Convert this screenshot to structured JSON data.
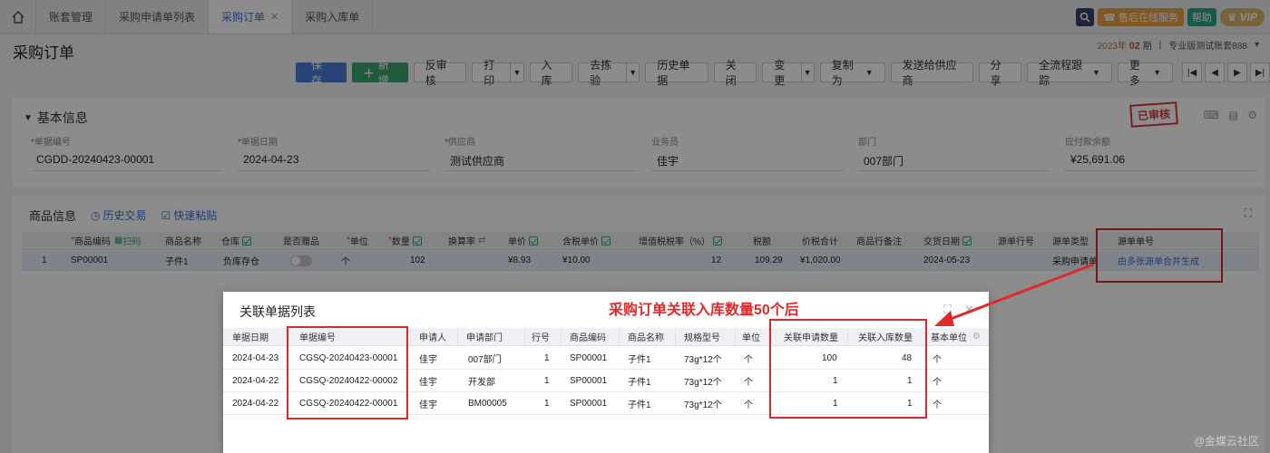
{
  "tabs": [
    {
      "label": "账套管理",
      "active": false
    },
    {
      "label": "采购申请单列表",
      "active": false
    },
    {
      "label": "采购订单",
      "active": true,
      "closable": true
    },
    {
      "label": "采购入库单",
      "active": false
    }
  ],
  "topbar": {
    "service": "售后在线服务",
    "help": "帮助",
    "vip": "VIP"
  },
  "page_title": "采购订单",
  "period": {
    "year": "2023年",
    "month": "02",
    "month_suffix": "期",
    "account": "专业版测试账套888"
  },
  "toolbar": {
    "save": "保存",
    "new": "新增",
    "unapprove": "反审核",
    "print": "打印",
    "stock_in": "入库",
    "inspect": "去拣验",
    "history": "历史单据",
    "close": "关闭",
    "change": "变更",
    "copy_as": "复制为",
    "send_supplier": "发送给供应商",
    "share": "分享",
    "track": "全流程跟踪",
    "more": "更多"
  },
  "basic_info": {
    "title": "基本信息",
    "stamp": "已审核",
    "fields": [
      {
        "label": "单据编号",
        "required": true,
        "value": "CGDD-20240423-00001"
      },
      {
        "label": "单据日期",
        "required": true,
        "value": "2024-04-23"
      },
      {
        "label": "供应商",
        "required": true,
        "value": "测试供应商"
      },
      {
        "label": "业务员",
        "required": false,
        "value": "佳宇"
      },
      {
        "label": "部门",
        "required": false,
        "value": "007部门"
      },
      {
        "label": "应付款余额",
        "required": false,
        "value": "¥25,691.06"
      }
    ]
  },
  "items": {
    "title": "商品信息",
    "history_link": "历史交易",
    "paste_link": "快速粘贴",
    "scan_label": "扫码",
    "headers": {
      "product_code": "商品编码",
      "product_name": "商品名称",
      "warehouse": "仓库",
      "is_gift": "是否赠品",
      "unit": "单位",
      "quantity": "数量",
      "conversion": "换算率",
      "price": "单价",
      "tax_price": "含税单价",
      "vat_rate": "增值税税率（%）",
      "tax": "税额",
      "total": "价税合计",
      "remark": "商品行备注",
      "delivery_date": "交货日期",
      "source_line": "源单行号",
      "source_type": "源单类型",
      "source_no": "源单单号"
    },
    "row": {
      "index": "1",
      "product_code": "SP00001",
      "product_name": "子件1",
      "warehouse": "负库存仓",
      "unit": "个",
      "quantity": "102",
      "price": "¥8.93",
      "tax_price": "¥10.00",
      "vat_rate": "12",
      "tax": "109.29",
      "total": "¥1,020.00",
      "delivery_date": "2024-05-23",
      "source_type": "采购申请单",
      "source_no": "由多张源单合并生成"
    }
  },
  "annotation": "采购订单关联入库数量50个后",
  "modal": {
    "title": "关联单据列表",
    "headers": {
      "date": "单据日期",
      "number": "单据编号",
      "applicant": "申请人",
      "dept": "申请部门",
      "line": "行号",
      "code": "商品编码",
      "name": "商品名称",
      "spec": "规格型号",
      "unit": "单位",
      "req_qty": "关联申请数量",
      "in_qty": "关联入库数量",
      "base_unit": "基本单位"
    },
    "rows": [
      {
        "date": "2024-04-23",
        "number": "CGSQ-20240423-00001",
        "applicant": "佳宇",
        "dept": "007部门",
        "line": "1",
        "code": "SP00001",
        "name": "子件1",
        "spec": "73g*12个",
        "unit": "个",
        "req_qty": "100",
        "in_qty": "48",
        "base_unit": "个"
      },
      {
        "date": "2024-04-22",
        "number": "CGSQ-20240422-00002",
        "applicant": "佳宇",
        "dept": "开发部",
        "line": "1",
        "code": "SP00001",
        "name": "子件1",
        "spec": "73g*12个",
        "unit": "个",
        "req_qty": "1",
        "in_qty": "1",
        "base_unit": "个"
      },
      {
        "date": "2024-04-22",
        "number": "CGSQ-20240422-00001",
        "applicant": "佳宇",
        "dept": "BM00005",
        "line": "1",
        "code": "SP00001",
        "name": "子件1",
        "spec": "73g*12个",
        "unit": "个",
        "req_qty": "1",
        "in_qty": "1",
        "base_unit": "个"
      }
    ]
  },
  "watermark": "@金蝶云社区",
  "colors": {
    "primary": "#4a7bd8",
    "success": "#3ba56d",
    "highlight": "#d42a2a",
    "link": "#3b6fd8"
  }
}
